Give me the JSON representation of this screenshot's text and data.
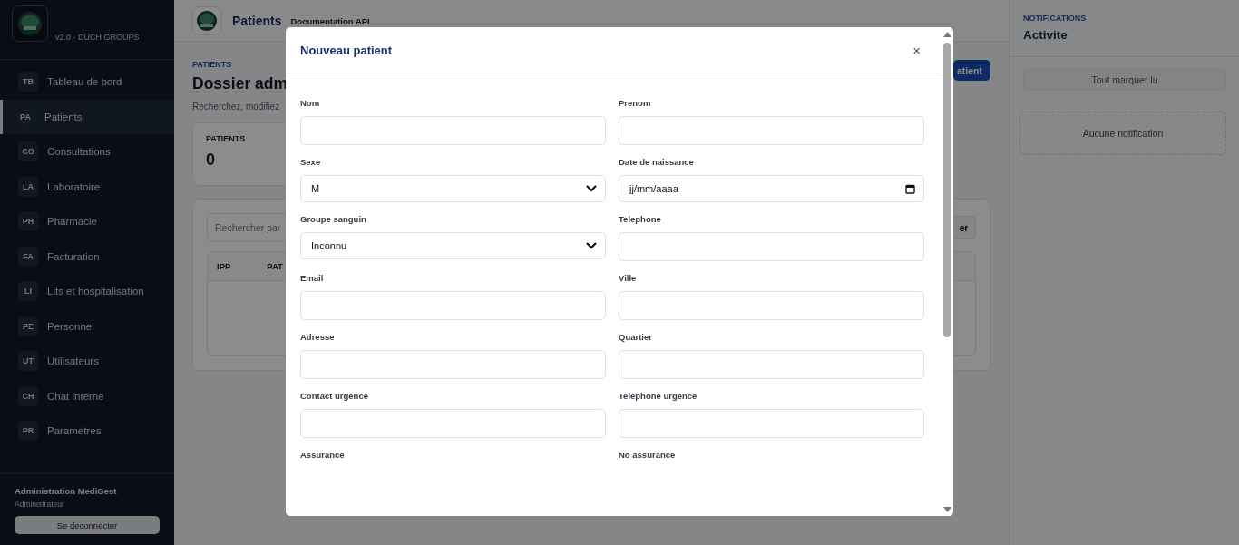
{
  "sidebar": {
    "version": "v2.0 - DUCH GROUPS",
    "items": [
      {
        "abbr": "TB",
        "label": "Tableau de bord",
        "selected": false
      },
      {
        "abbr": "PA",
        "label": "Patients",
        "selected": true
      },
      {
        "abbr": "CO",
        "label": "Consultations",
        "selected": false
      },
      {
        "abbr": "LA",
        "label": "Laboratoire",
        "selected": false
      },
      {
        "abbr": "PH",
        "label": "Pharmacie",
        "selected": false
      },
      {
        "abbr": "FA",
        "label": "Facturation",
        "selected": false
      },
      {
        "abbr": "LI",
        "label": "Lits et hospitalisation",
        "selected": false
      },
      {
        "abbr": "PE",
        "label": "Personnel",
        "selected": false
      },
      {
        "abbr": "UT",
        "label": "Utilisateurs",
        "selected": false
      },
      {
        "abbr": "CH",
        "label": "Chat interne",
        "selected": false
      },
      {
        "abbr": "PR",
        "label": "Parametres",
        "selected": false
      }
    ],
    "user": {
      "name": "Administration MediGest",
      "role": "Administrateur",
      "logout": "Se deconnecter"
    }
  },
  "topbar": {
    "title": "Patients",
    "link": "Documentation API"
  },
  "page": {
    "eyebrow": "PATIENTS",
    "title": "Dossier adm",
    "subtitle": "Recherchez, modifiez",
    "action": "atient",
    "stat": {
      "label": "PATIENTS",
      "value": "0"
    },
    "search": {
      "placeholder": "Rechercher par",
      "button": "er"
    },
    "table": {
      "columns": [
        "IPP",
        "PAT"
      ]
    }
  },
  "notifications": {
    "eyebrow": "NOTIFICATIONS",
    "title": "Activite",
    "mark_all": "Tout marquer lu",
    "empty": "Aucune notification"
  },
  "modal": {
    "title": "Nouveau patient",
    "close": "×",
    "fields": [
      {
        "label": "Nom",
        "kind": "text"
      },
      {
        "label": "Prenom",
        "kind": "text"
      },
      {
        "label": "Sexe",
        "kind": "select",
        "value": "M"
      },
      {
        "label": "Date de naissance",
        "kind": "date",
        "placeholder": "jj/mm/aaaa"
      },
      {
        "label": "Groupe sanguin",
        "kind": "select",
        "value": "Inconnu"
      },
      {
        "label": "Telephone",
        "kind": "text"
      },
      {
        "label": "Email",
        "kind": "text"
      },
      {
        "label": "Ville",
        "kind": "text"
      },
      {
        "label": "Adresse",
        "kind": "text"
      },
      {
        "label": "Quartier",
        "kind": "text"
      },
      {
        "label": "Contact urgence",
        "kind": "text"
      },
      {
        "label": "Telephone urgence",
        "kind": "text"
      },
      {
        "label": "Assurance",
        "kind": "label"
      },
      {
        "label": "No assurance",
        "kind": "label"
      }
    ]
  }
}
